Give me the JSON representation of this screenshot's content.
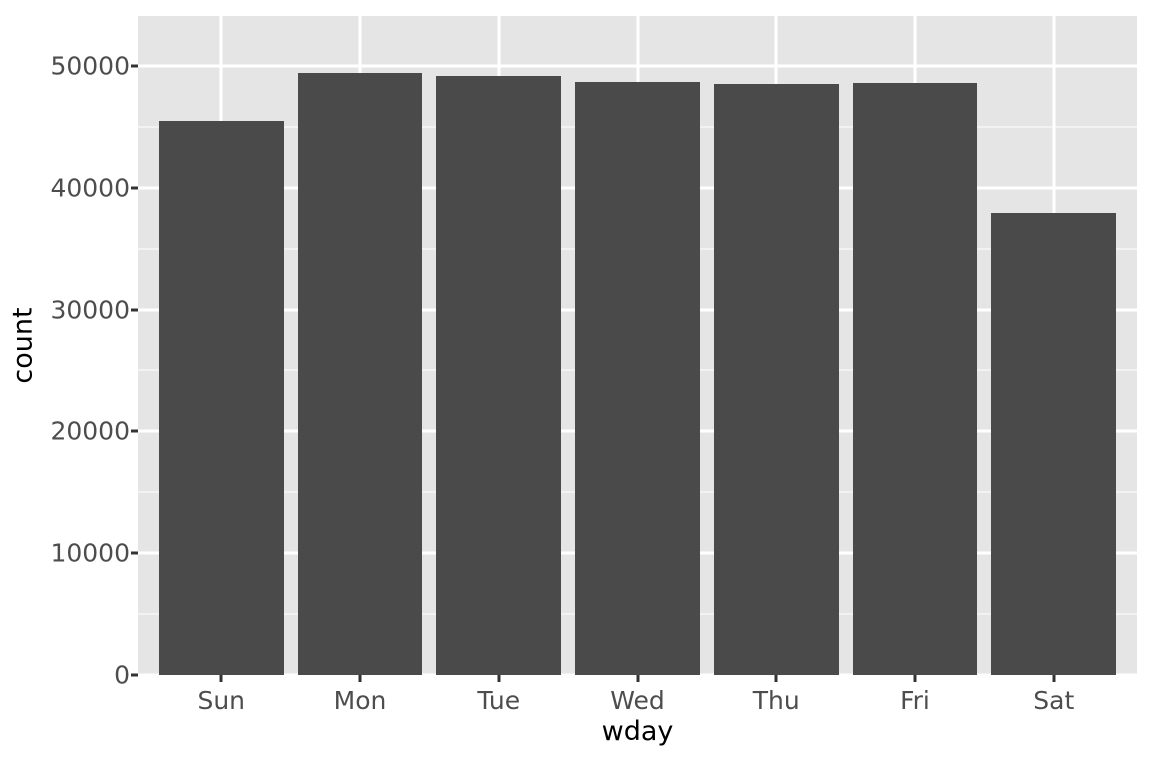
{
  "chart_data": {
    "type": "bar",
    "title": "",
    "subtitle": "",
    "xlabel": "wday",
    "ylabel": "count",
    "categories": [
      "Sun",
      "Mon",
      "Tue",
      "Wed",
      "Thu",
      "Fri",
      "Sat"
    ],
    "values": [
      45500,
      49450,
      49200,
      48700,
      48500,
      48600,
      37900
    ],
    "series": [
      {
        "name": "count",
        "values": [
          45500,
          49450,
          49200,
          48700,
          48500,
          48600,
          37900
        ]
      }
    ],
    "ylim": [
      0,
      54100
    ],
    "xlim": [
      0.4,
      7.6
    ],
    "y_ticks": [
      0,
      10000,
      20000,
      30000,
      40000,
      50000
    ],
    "y_tick_labels": [
      "0",
      "10000",
      "20000",
      "30000",
      "40000",
      "50000"
    ],
    "y_minor_ticks": [
      5000,
      15000,
      25000,
      35000,
      45000
    ],
    "x_ticks": [
      "Sun",
      "Mon",
      "Tue",
      "Wed",
      "Thu",
      "Fri",
      "Sat"
    ],
    "grid": true,
    "grid_color": "#ffffff",
    "minor_grid_color": "#f2f2f2",
    "panel_background": "#e5e5e5",
    "bar_color": "#4a4a4a",
    "bar_width_fraction": 0.9,
    "legend": null,
    "legend_position": "none",
    "plot_background": "#ffffff",
    "axis_text_color": "#4d4d4d",
    "axis_title_color": "#000000"
  },
  "axis": {
    "y_title": "count",
    "x_title": "wday"
  }
}
